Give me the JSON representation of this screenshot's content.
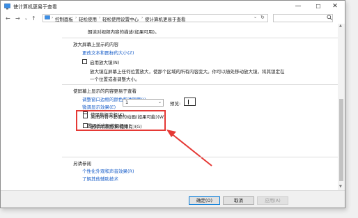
{
  "window": {
    "title": "使计算机更易于查看",
    "minimize_icon": "minimize-icon",
    "maximize_icon": "maximize-icon",
    "close_icon": "close-icon"
  },
  "address": {
    "back_icon": "arrow-left-icon",
    "forward_icon": "arrow-right-icon",
    "up_icon": "arrow-up-icon",
    "breadcrumb": [
      "控制面板",
      "轻松使用",
      "轻松使用设置中心",
      "使计算机更易于查看"
    ],
    "search_placeholder": ""
  },
  "content": {
    "top_text": "朗读对视频内容的描述(如果可用)。",
    "magnify": {
      "header": "放大屏幕上显示的内容",
      "link": "更改文本和图标的大小(Z)",
      "checkbox_label": "启用放大镜(N)",
      "checked": false,
      "desc_line1": "放大镜在屏幕上任何位置放大，使那个区域的所有内容变大。你可以随处移动放大镜，将其锁定在",
      "desc_line2": "一个位置或者调整大小。"
    },
    "visibility": {
      "header": "使屏幕上显示的内容更易于查看",
      "link1": "调整窗口边框的颜色和透明度(I)",
      "link2": "微调显示效果(E)",
      "focus_checkbox": "使聚焦框变粗(K)",
      "cursor_label": "设置闪烁光标的粗细(B):",
      "cursor_value": "1",
      "preview_label": "预览:",
      "animations_checkbox": "关闭所有不必要的动画(如果可能)(W)",
      "background_checkbox": "删除背景图像(如果有)(G)"
    },
    "see_also": {
      "header": "另请参阅",
      "link1": "个性化外观和声音效果(R)",
      "link2": "了解其他辅助技术"
    }
  },
  "buttons": {
    "ok": "确定(O)",
    "cancel": "取消",
    "apply": "应用(A)"
  },
  "colors": {
    "link": "#1a5fc9",
    "highlight": "#e53935",
    "ok_border": "#0078d7"
  }
}
